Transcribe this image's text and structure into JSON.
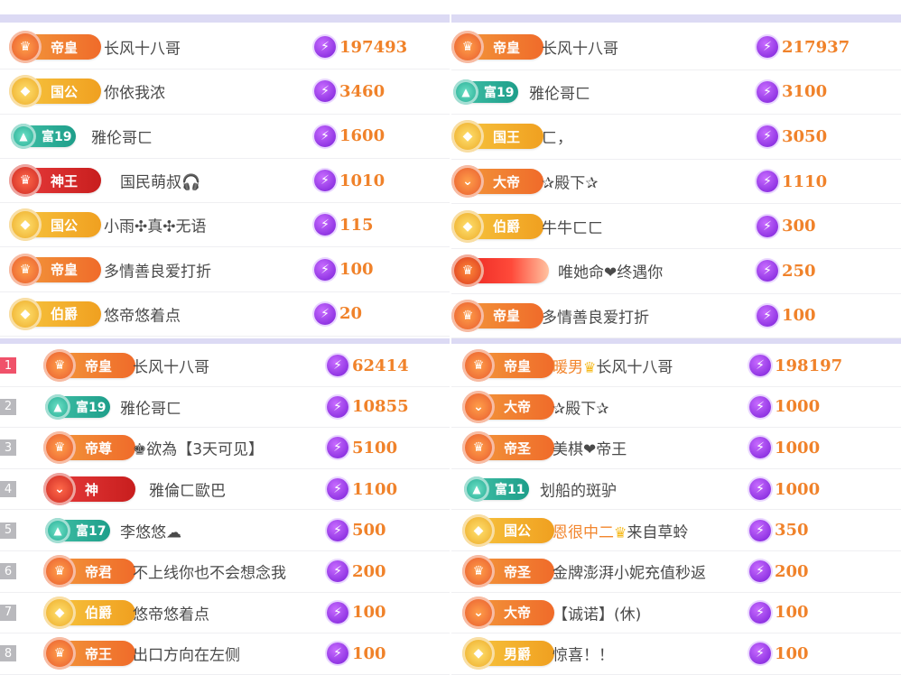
{
  "colors": {
    "accent": "#f0822a",
    "separator": "#dcdaf4",
    "bolt": "#8b2cf0",
    "rank_first": "#f0526a",
    "rank_other": "#b9b9bd"
  },
  "icons": {
    "score": "lightning-bolt-icon"
  },
  "panels": [
    {
      "rows": [
        {
          "badge": "帝皇",
          "name": "长风十八哥",
          "score": "197493"
        },
        {
          "badge": "国公",
          "name": "你依我浓",
          "score": "3460"
        },
        {
          "badge": "富19",
          "name": "雅伦哥ㄈ",
          "score": "1600"
        },
        {
          "badge": "神王",
          "name": "国民萌叔🎧",
          "score": "1010"
        },
        {
          "badge": "国公",
          "name": "小雨✣真✣无语",
          "score": "115"
        },
        {
          "badge": "帝皇",
          "name": "多情善良爱打折",
          "score": "100"
        },
        {
          "badge": "伯爵",
          "name": "悠帝悠着点",
          "score": "20"
        }
      ]
    },
    {
      "rows": [
        {
          "badge": "帝皇",
          "name": "长风十八哥",
          "score": "217937"
        },
        {
          "badge": "富19",
          "name": "雅伦哥ㄈ",
          "score": "3100"
        },
        {
          "badge": "国王",
          "name": "ㄈ，",
          "score": "3050"
        },
        {
          "badge": "大帝",
          "name": "✰殿下✰",
          "score": "1110"
        },
        {
          "badge": "伯爵",
          "name": "牛牛ㄈㄈ",
          "score": "300"
        },
        {
          "badge": "",
          "name": "唯她命❤终遇你",
          "score": "250"
        },
        {
          "badge": "帝皇",
          "name": "多情善良爱打折",
          "score": "100"
        }
      ]
    },
    {
      "rows": [
        {
          "rank": "1",
          "badge": "帝皇",
          "name": "长风十八哥",
          "score": "62414"
        },
        {
          "rank": "2",
          "badge": "富19",
          "name": "雅伦哥ㄈ",
          "score": "10855"
        },
        {
          "rank": "3",
          "badge": "帝尊",
          "name": "♚欲為【3天可见】",
          "score": "5100"
        },
        {
          "rank": "4",
          "badge": "神",
          "name": "雅倫ㄈ歐巴",
          "score": "1100"
        },
        {
          "rank": "5",
          "badge": "富17",
          "name": "李悠悠☁",
          "score": "500"
        },
        {
          "rank": "6",
          "badge": "帝君",
          "name": "不上线你也不会想念我",
          "score": "200"
        },
        {
          "rank": "7",
          "badge": "伯爵",
          "name": "悠帝悠着点",
          "score": "100"
        },
        {
          "rank": "8",
          "badge": "帝王",
          "name": "出口方向在左侧",
          "score": "100"
        }
      ]
    },
    {
      "rows": [
        {
          "badge": "帝皇",
          "name_hl": "暖男",
          "name": "长风十八哥",
          "score": "198197"
        },
        {
          "badge": "大帝",
          "name": "✰殿下✰",
          "score": "1000"
        },
        {
          "badge": "帝圣",
          "name": "美棋❤帝王",
          "score": "1000"
        },
        {
          "badge": "富11",
          "name": "划船的斑驴",
          "score": "1000"
        },
        {
          "badge": "国公",
          "name_hl": "恩很中二",
          "name": "来自草蛉",
          "score": "350"
        },
        {
          "badge": "帝圣",
          "name": "金牌澎湃小妮充值秒返",
          "score": "200"
        },
        {
          "badge": "大帝",
          "name": "【诚诺】(休)",
          "score": "100"
        },
        {
          "badge": "男爵",
          "name": "惊喜！！",
          "score": "100"
        }
      ]
    }
  ]
}
